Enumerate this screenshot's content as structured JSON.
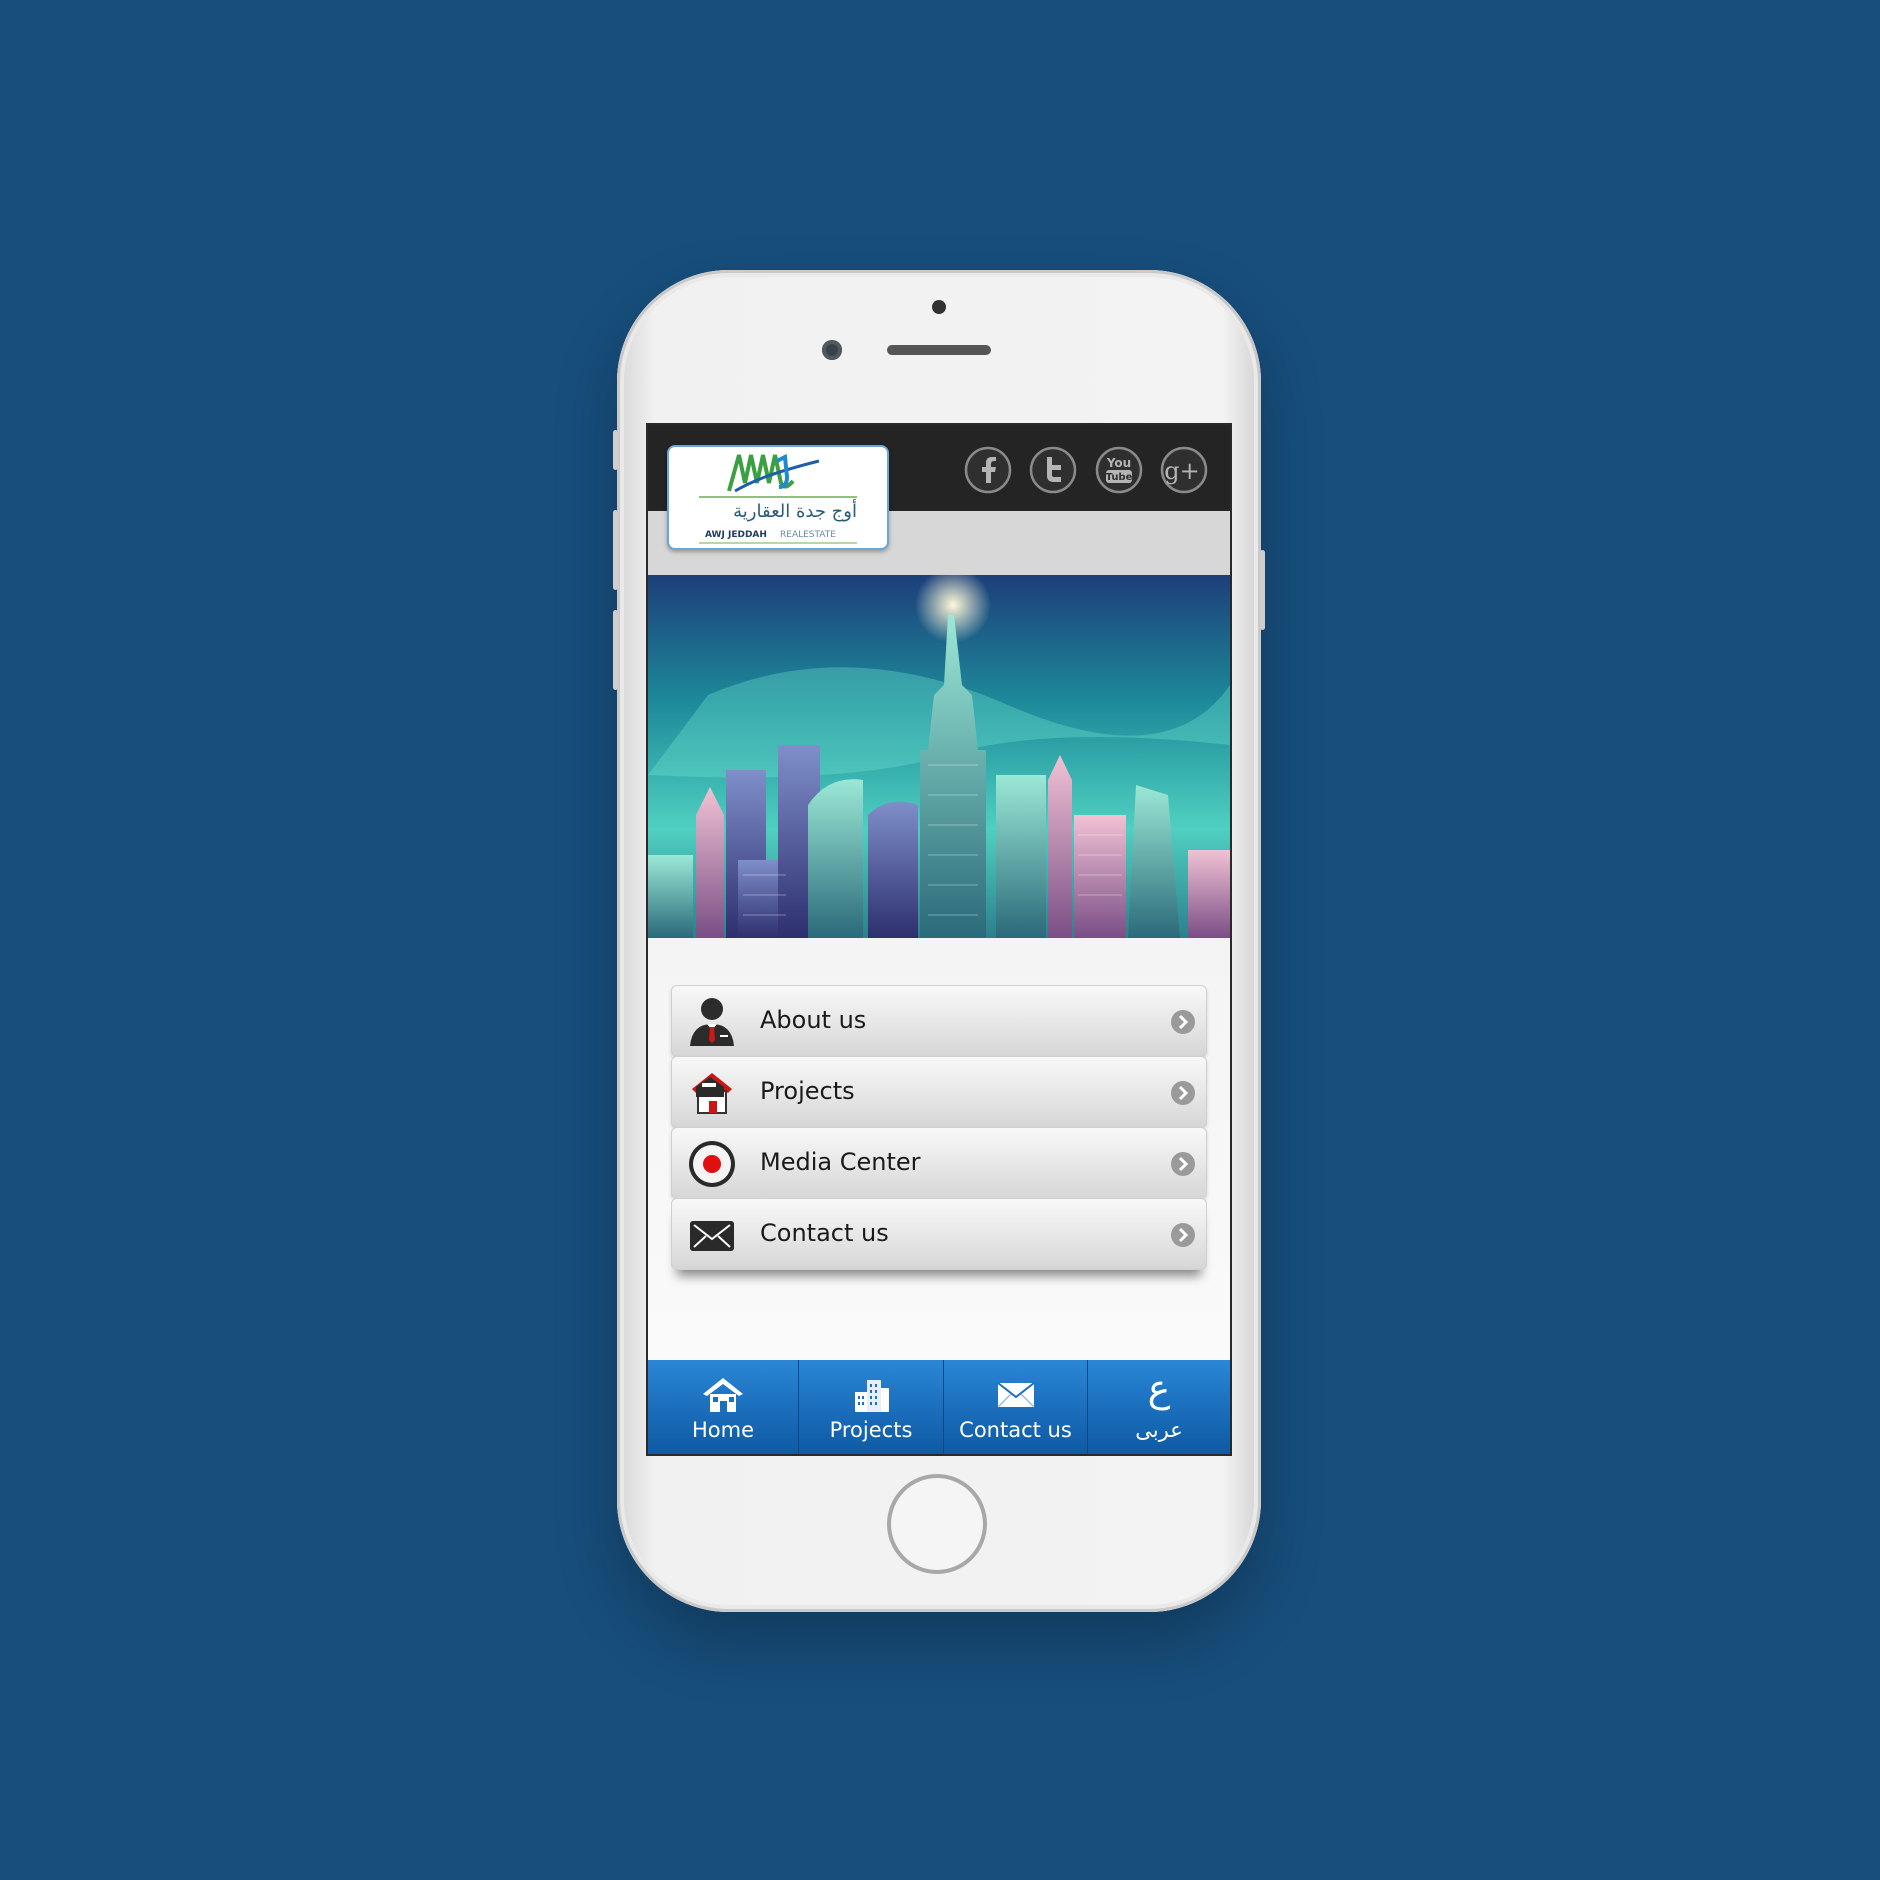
{
  "header": {
    "logo": {
      "arabic_name": "أوج جدة العقارية",
      "english_name": "AWJ JEDDAH",
      "english_suffix": "REALESTATE",
      "monogram": "AWJ"
    },
    "social": [
      {
        "name": "facebook-icon",
        "glyph": "f"
      },
      {
        "name": "twitter-icon",
        "glyph": "t"
      },
      {
        "name": "youtube-icon",
        "glyph_top": "You",
        "glyph_bottom": "Tube"
      },
      {
        "name": "google-plus-icon",
        "glyph": "g+"
      }
    ]
  },
  "menu": {
    "items": [
      {
        "label": "About us",
        "icon": "person-icon"
      },
      {
        "label": "Projects",
        "icon": "house-icon"
      },
      {
        "label": "Media Center",
        "icon": "record-icon"
      },
      {
        "label": "Contact us",
        "icon": "envelope-icon"
      }
    ]
  },
  "tabbar": {
    "tabs": [
      {
        "label": "Home",
        "icon": "home-icon"
      },
      {
        "label": "Projects",
        "icon": "buildings-icon"
      },
      {
        "label": "Contact us",
        "icon": "mail-icon"
      },
      {
        "label": "عربى",
        "icon": "arabic-letter-icon",
        "glyph": "ع"
      }
    ]
  },
  "colors": {
    "background": "#174e7c",
    "tabbar": "#1b6fbd",
    "topbar": "#242424",
    "record_red": "#e01010"
  }
}
